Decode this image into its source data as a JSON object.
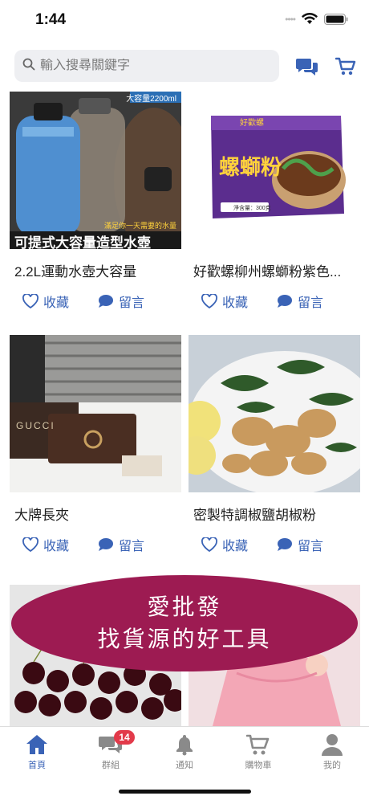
{
  "status": {
    "time": "1:44"
  },
  "search": {
    "placeholder": "輸入搜尋關鍵字"
  },
  "products": [
    {
      "title": "2.2L運動水壺大容量",
      "img_text_top": "大容量2200ml",
      "img_text_mid": "滿足你一天需要的水量",
      "img_text_bottom": "可提式大容量造型水壺"
    },
    {
      "title": "好歡螺柳州螺螄粉紫色...",
      "img_brand": "好歡螺",
      "img_text_main": "螺螄粉",
      "img_text_sub": "淨含量：300克"
    },
    {
      "title": "大牌長夾",
      "img_brand": "GUCCI"
    },
    {
      "title": "密製特調椒鹽胡椒粉"
    }
  ],
  "actions": {
    "favorite": "收藏",
    "comment": "留言"
  },
  "banner": {
    "line1": "愛批發",
    "line2": "找貨源的好工具"
  },
  "tabs": [
    {
      "label": "首頁",
      "icon": "home-icon",
      "active": true
    },
    {
      "label": "群組",
      "icon": "chat-icon",
      "badge": "14"
    },
    {
      "label": "通知",
      "icon": "bell-icon"
    },
    {
      "label": "購物車",
      "icon": "cart-icon"
    },
    {
      "label": "我的",
      "icon": "person-icon"
    }
  ],
  "colors": {
    "accent": "#3a63b6",
    "banner": "#9d1b52",
    "badge": "#e23a4a"
  }
}
